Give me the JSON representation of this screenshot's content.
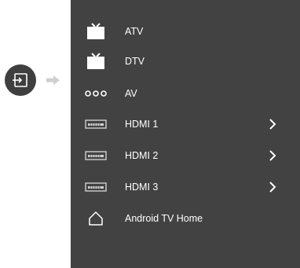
{
  "source_button": {
    "icon": "input-source-icon"
  },
  "hint": {
    "icon": "right-arrow-icon"
  },
  "menu": {
    "items": [
      {
        "label": "ATV",
        "icon": "tv-icon",
        "has_submenu": false
      },
      {
        "label": "DTV",
        "icon": "tv-icon",
        "has_submenu": false
      },
      {
        "label": "AV",
        "icon": "av-dots-icon",
        "has_submenu": false
      },
      {
        "label": "HDMI 1",
        "icon": "hdmi-port-icon",
        "has_submenu": true
      },
      {
        "label": "HDMI 2",
        "icon": "hdmi-port-icon",
        "has_submenu": true
      },
      {
        "label": "HDMI 3",
        "icon": "hdmi-port-icon",
        "has_submenu": true
      },
      {
        "label": "Android TV Home",
        "icon": "home-icon",
        "has_submenu": false
      }
    ]
  },
  "colors": {
    "panel": "#424242",
    "button": "#3f3f3f",
    "text": "#ffffff",
    "hint": "#cfcfcf"
  }
}
